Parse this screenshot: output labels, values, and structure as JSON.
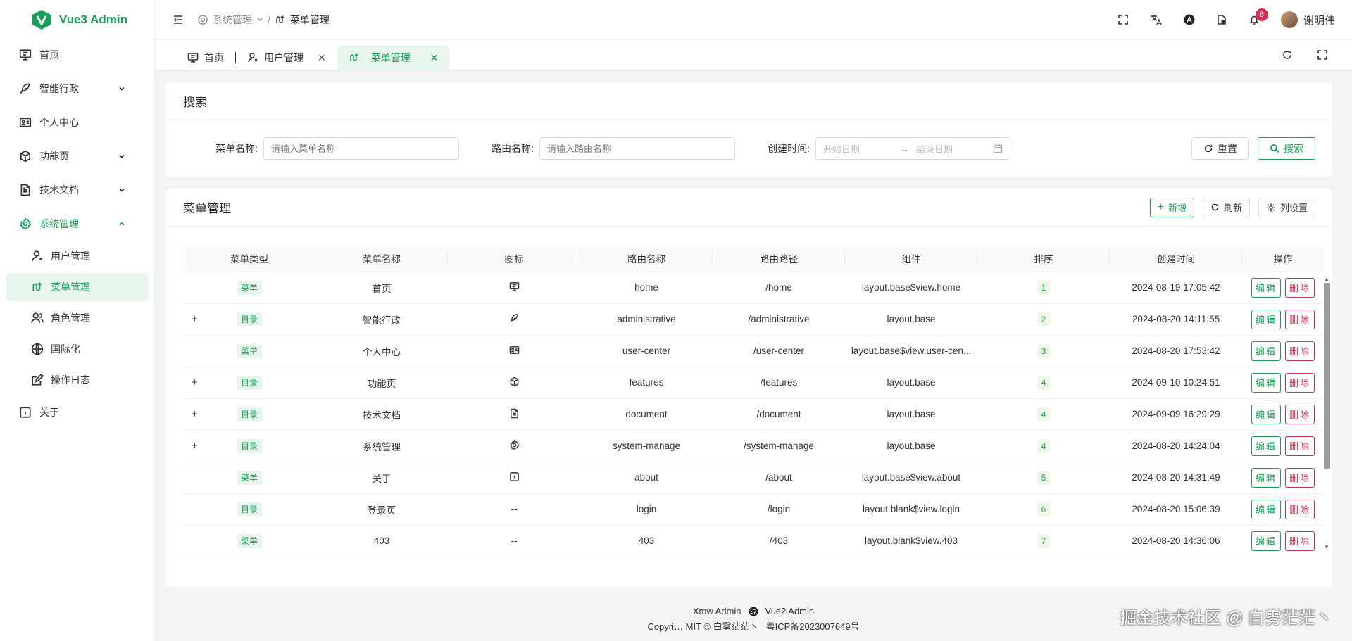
{
  "app": {
    "title": "Vue3 Admin"
  },
  "sidebar": {
    "items": [
      {
        "label": "首页",
        "icon": "monitor-icon",
        "has_children": false
      },
      {
        "label": "智能行政",
        "icon": "feather-icon",
        "has_children": true
      },
      {
        "label": "个人中心",
        "icon": "id-card-icon",
        "has_children": false
      },
      {
        "label": "功能页",
        "icon": "cube-icon",
        "has_children": true
      },
      {
        "label": "技术文档",
        "icon": "document-icon",
        "has_children": true
      },
      {
        "label": "系统管理",
        "icon": "gear-icon",
        "has_children": true,
        "expanded": true
      },
      {
        "label": "关于",
        "icon": "info-icon",
        "has_children": false
      }
    ],
    "sub_items": [
      {
        "label": "用户管理",
        "icon": "user-icon"
      },
      {
        "label": "菜单管理",
        "icon": "route-icon",
        "active": true
      },
      {
        "label": "角色管理",
        "icon": "user-group-icon"
      },
      {
        "label": "国际化",
        "icon": "globe-icon"
      },
      {
        "label": "操作日志",
        "icon": "edit-log-icon"
      }
    ]
  },
  "header": {
    "breadcrumb": [
      "系统管理",
      "菜单管理"
    ],
    "notification_count": "6",
    "username": "谢明伟"
  },
  "tabs": [
    {
      "label": "首页",
      "closable": false
    },
    {
      "label": "用户管理",
      "closable": true
    },
    {
      "label": "菜单管理",
      "closable": true,
      "active": true
    }
  ],
  "search": {
    "title": "搜索",
    "menu_name_label": "菜单名称:",
    "menu_name_placeholder": "请输入菜单名称",
    "route_name_label": "路由名称:",
    "route_name_placeholder": "请输入路由名称",
    "created_label": "创建时间:",
    "start_placeholder": "开始日期",
    "end_placeholder": "结束日期",
    "reset_label": "重置",
    "search_label": "搜索"
  },
  "table": {
    "title": "菜单管理",
    "add_label": "新增",
    "refresh_label": "刷新",
    "columns_label": "列设置",
    "headers": [
      "菜单类型",
      "菜单名称",
      "图标",
      "路由名称",
      "路由路径",
      "组件",
      "排序",
      "创建时间",
      "操作"
    ],
    "edit_label": "编辑",
    "delete_label": "删除",
    "rows": [
      {
        "expandable": false,
        "type": "菜单",
        "name": "首页",
        "icon": "monitor-icon",
        "route_name": "home",
        "path": "/home",
        "component": "layout.base$view.home",
        "order": "1",
        "created": "2024-08-19 17:05:42"
      },
      {
        "expandable": true,
        "type": "目录",
        "name": "智能行政",
        "icon": "feather-icon",
        "route_name": "administrative",
        "path": "/administrative",
        "component": "layout.base",
        "order": "2",
        "created": "2024-08-20 14:11:55"
      },
      {
        "expandable": false,
        "type": "菜单",
        "name": "个人中心",
        "icon": "id-card-icon",
        "route_name": "user-center",
        "path": "/user-center",
        "component": "layout.base$view.user-cen...",
        "order": "3",
        "created": "2024-08-20 17:53:42"
      },
      {
        "expandable": true,
        "type": "目录",
        "name": "功能页",
        "icon": "cube-icon",
        "route_name": "features",
        "path": "/features",
        "component": "layout.base",
        "order": "4",
        "created": "2024-09-10 10:24:51"
      },
      {
        "expandable": true,
        "type": "目录",
        "name": "技术文档",
        "icon": "document-icon",
        "route_name": "document",
        "path": "/document",
        "component": "layout.base",
        "order": "4",
        "created": "2024-09-09 16:29:29"
      },
      {
        "expandable": true,
        "type": "目录",
        "name": "系统管理",
        "icon": "gear-icon",
        "route_name": "system-manage",
        "path": "/system-manage",
        "component": "layout.base",
        "order": "4",
        "created": "2024-08-20 14:24:04"
      },
      {
        "expandable": false,
        "type": "菜单",
        "name": "关于",
        "icon": "info-icon",
        "route_name": "about",
        "path": "/about",
        "component": "layout.base$view.about",
        "order": "5",
        "created": "2024-08-20 14:31:49"
      },
      {
        "expandable": false,
        "type": "目录",
        "name": "登录页",
        "icon": "--",
        "route_name": "login",
        "path": "/login",
        "component": "layout.blank$view.login",
        "order": "6",
        "created": "2024-08-20 15:06:39"
      },
      {
        "expandable": false,
        "type": "菜单",
        "name": "403",
        "icon": "--",
        "route_name": "403",
        "path": "/403",
        "component": "layout.blank$view.403",
        "order": "7",
        "created": "2024-08-20 14:36:06"
      }
    ]
  },
  "footer": {
    "link1": "Xmw Admin",
    "link2": "Vue2 Admin",
    "copyright": "Copyri… MIT © 白雾茫茫丶",
    "icp": "粤ICP备2023007649号"
  },
  "watermark": "掘金技术社区 @ 白雾茫茫丶",
  "colors": {
    "primary": "#18a058",
    "danger": "#d03050"
  }
}
